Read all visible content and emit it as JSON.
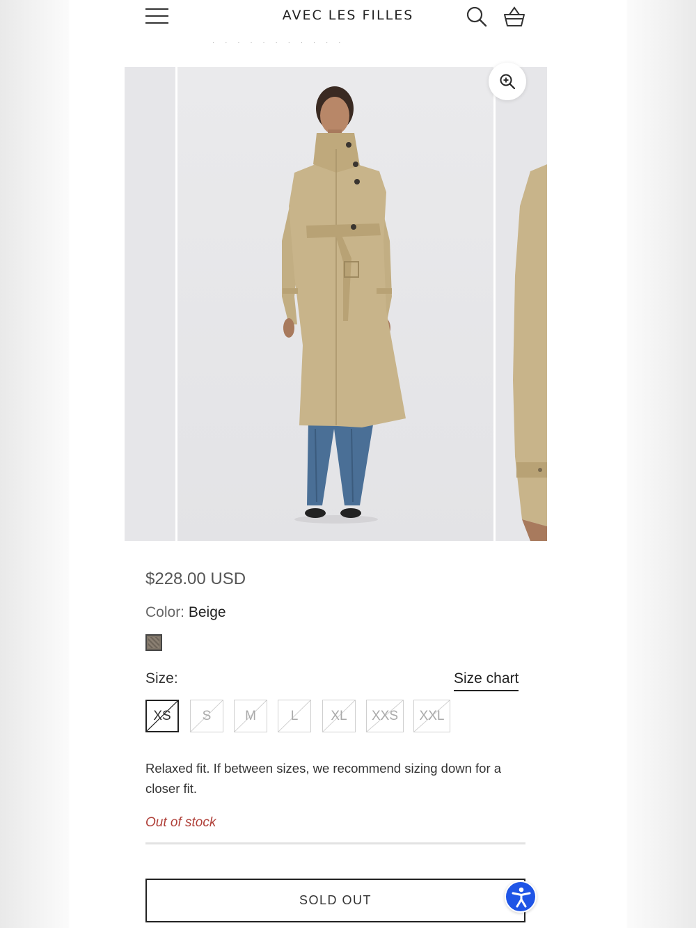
{
  "header": {
    "brand": "AVEC LES FILLES",
    "icons": [
      "menu-icon",
      "search-icon",
      "cart-icon"
    ],
    "pager_dots": "· · · · · · · · · · ·"
  },
  "gallery": {
    "icons": [
      "zoom-in-icon"
    ],
    "product_colors": {
      "coat": "#c8b48a",
      "jeans": "#4a6f96",
      "background": "#e6e6e9"
    }
  },
  "product": {
    "price": "$228.00 USD",
    "color_label": "Color:",
    "color_value": "Beige",
    "swatch_color": "#7f7568",
    "size_label": "Size:",
    "size_chart": "Size chart",
    "sizes": [
      {
        "label": "XS",
        "selected": true,
        "available": false
      },
      {
        "label": "S",
        "selected": false,
        "available": false
      },
      {
        "label": "M",
        "selected": false,
        "available": false
      },
      {
        "label": "L",
        "selected": false,
        "available": false
      },
      {
        "label": "XL",
        "selected": false,
        "available": false
      },
      {
        "label": "XXS",
        "selected": false,
        "available": false
      },
      {
        "label": "XXL",
        "selected": false,
        "available": false
      }
    ],
    "fit_note": "Relaxed fit. If between sizes, we recommend sizing down for a closer fit.",
    "stock_status": "Out of stock",
    "stock_color": "#b0413a",
    "button_label": "SOLD OUT"
  },
  "accessibility": {
    "icon": "accessibility-icon",
    "color": "#1f55e6"
  }
}
